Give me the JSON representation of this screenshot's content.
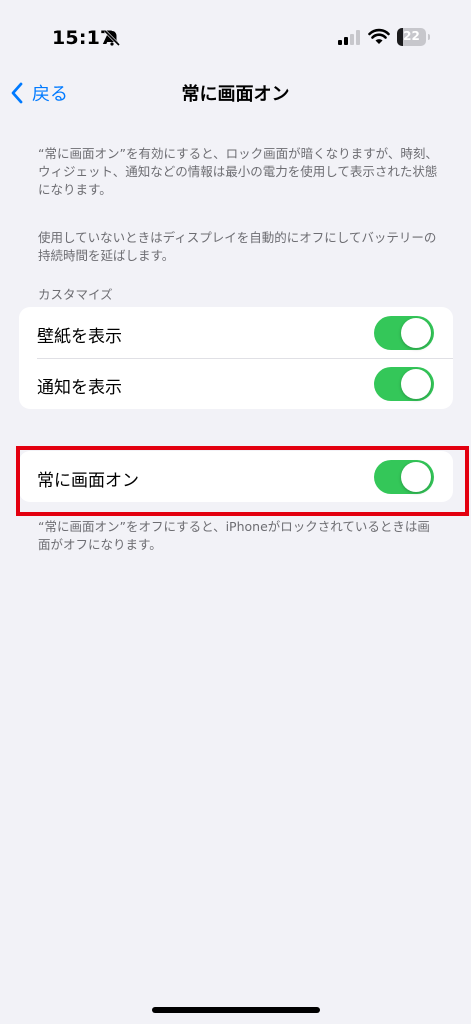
{
  "status_bar": {
    "time": "15:17",
    "battery_level": "22",
    "battery_fraction": 0.22,
    "icons": [
      "bell-slash-icon",
      "cellular-signal-icon",
      "wifi-icon",
      "battery-icon"
    ]
  },
  "nav": {
    "back_label": "戻る",
    "title": "常に画面オン"
  },
  "description_1": "“常に画面オン”を有効にすると、ロック画面が暗くなりますが、時刻、ウィジェット、通知などの情報は最小の電力を使用して表示された状態になります。",
  "description_2": "使用していないときはディスプレイを自動的にオフにしてバッテリーの持続時間を延ばします。",
  "customize": {
    "section_label": "カスタマイズ",
    "rows": [
      {
        "label": "壁紙を表示",
        "enabled": true
      },
      {
        "label": "通知を表示",
        "enabled": true
      }
    ]
  },
  "always_on": {
    "label": "常に画面オン",
    "enabled": true,
    "footer": "“常に画面オン”をオフにすると、iPhoneがロックされているときは画面がオフになります。"
  },
  "colors": {
    "accent": "#007aff",
    "toggle_on": "#34c759",
    "highlight_border": "#e3000f",
    "background": "#f2f2f7"
  }
}
